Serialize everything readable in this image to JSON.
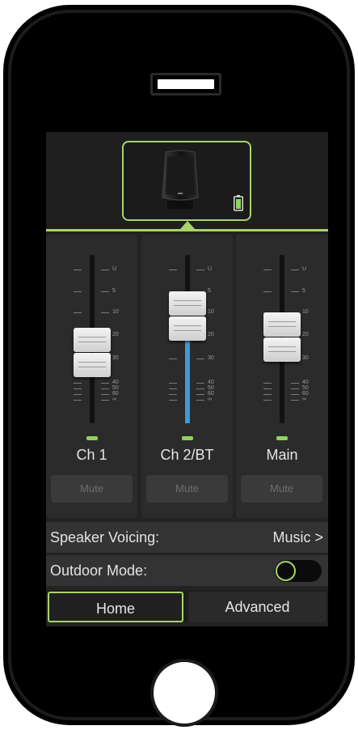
{
  "device": {
    "battery": "charging"
  },
  "channels": [
    {
      "name": "Ch 1",
      "mute_label": "Mute"
    },
    {
      "name": "Ch 2/BT",
      "mute_label": "Mute"
    },
    {
      "name": "Main",
      "mute_label": "Mute"
    }
  ],
  "scale_labels": [
    "U",
    "5",
    "10",
    "20",
    "30",
    "40",
    "50",
    "60",
    "∞"
  ],
  "speaker_voicing": {
    "label": "Speaker Voicing:",
    "value": "Music >"
  },
  "outdoor_mode": {
    "label": "Outdoor Mode:",
    "on": false
  },
  "tabs": {
    "home": "Home",
    "advanced": "Advanced"
  },
  "colors": {
    "accent": "#a8d46a",
    "level": "#3d9bd6",
    "screen_bg": "#232323"
  }
}
